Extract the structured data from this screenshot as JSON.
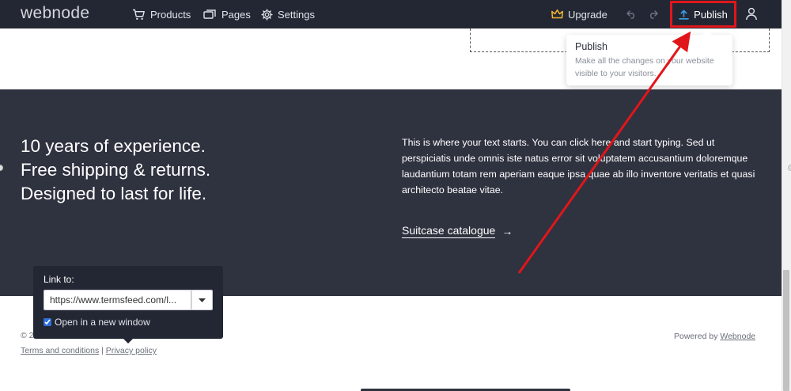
{
  "app": {
    "logo": "webnode"
  },
  "nav": {
    "products": "Products",
    "pages": "Pages",
    "settings": "Settings",
    "upgrade": "Upgrade",
    "publish": "Publish"
  },
  "tooltip": {
    "title": "Publish",
    "text": "Make all the changes on your website visible to your visitors."
  },
  "hero": {
    "lines": [
      "10 years of experience.",
      "Free shipping & returns.",
      "Designed to last for life."
    ],
    "body": "This is where your text starts. You can click here and start typing. Sed ut perspiciatis unde omnis iste natus error sit voluptatem accusantium doloremque laudantium totam rem aperiam eaque ipsa quae ab illo inventore veritatis et quasi architecto beatae vitae.",
    "cta": "Suitcase catalogue",
    "cta_arrow": "→"
  },
  "footer": {
    "copyright": "© 2",
    "terms": "Terms and conditions",
    "separator": "|",
    "privacy": "Privacy policy",
    "powered_prefix": "Powered by ",
    "powered_link": "Webnode"
  },
  "link_popup": {
    "label": "Link to:",
    "url": "https://www.termsfeed.com/l...",
    "checkbox_label": "Open in a new window",
    "checkbox_checked": true
  },
  "colors": {
    "topbar": "#232734",
    "dark_section": "#2f323f",
    "highlight": "#e0161b",
    "upgrade_crown": "#f2b631",
    "publish_icon": "#3aa0e6"
  }
}
